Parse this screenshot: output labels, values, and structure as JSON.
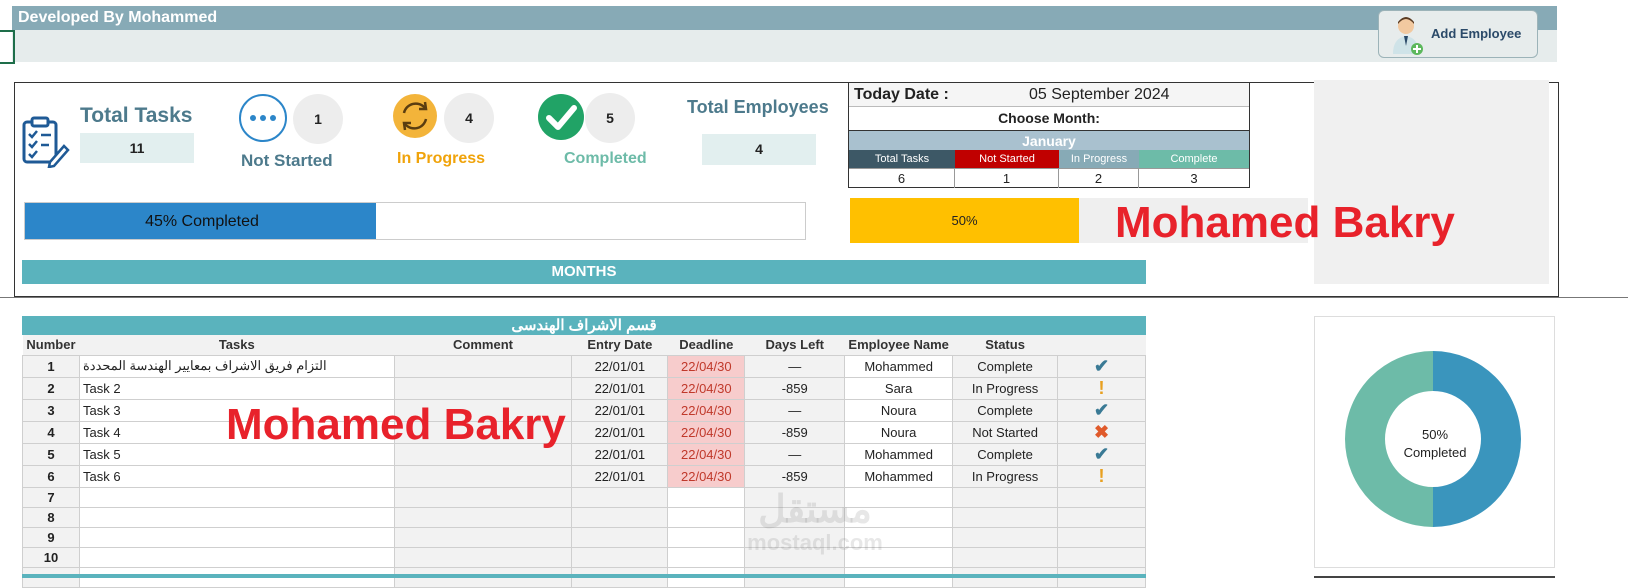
{
  "header": {
    "developer": "Developed By Mohammed",
    "add_employee_label": "Add Employee"
  },
  "kpis": {
    "total_tasks_label": "Total Tasks",
    "total_tasks_value": "11",
    "not_started_label": "Not Started",
    "not_started_value": "1",
    "in_progress_label": "In Progress",
    "in_progress_value": "4",
    "completed_label": "Completed",
    "completed_value": "5",
    "total_employees_label": "Total Employees",
    "total_employees_value": "4"
  },
  "date_block": {
    "today_label": "Today Date :",
    "today_value": "05 September 2024",
    "choose_month_label": "Choose Month:",
    "selected_month": "January",
    "columns": [
      "Total Tasks",
      "Not Started",
      "In Progress",
      "Complete"
    ],
    "values": [
      "6",
      "1",
      "2",
      "3"
    ]
  },
  "progress": {
    "overall_label": "45% Completed",
    "overall_fraction": 0.45,
    "month_label": "50%",
    "month_fraction": 0.5
  },
  "watermark_name": "Mohamed Bakry",
  "months_label": "MONTHS",
  "department_title": "قسم الاشراف الهندسى",
  "table": {
    "headers": [
      "Number",
      "Tasks",
      "Comment",
      "Entry Date",
      "Deadline",
      "Days Left",
      "Employee Name",
      "Status"
    ],
    "rows": [
      {
        "num": "1",
        "task": "التزام فريق الاشراف بمعايير الهندسة المحددة",
        "comment": "",
        "entry": "22/01/01",
        "deadline": "22/04/30",
        "days": "—",
        "employee": "Mohammed",
        "status": "Complete"
      },
      {
        "num": "2",
        "task": "Task 2",
        "comment": "",
        "entry": "22/01/01",
        "deadline": "22/04/30",
        "days": "-859",
        "employee": "Sara",
        "status": "In Progress"
      },
      {
        "num": "3",
        "task": "Task 3",
        "comment": "",
        "entry": "22/01/01",
        "deadline": "22/04/30",
        "days": "—",
        "employee": "Noura",
        "status": "Complete"
      },
      {
        "num": "4",
        "task": "Task 4",
        "comment": "",
        "entry": "22/01/01",
        "deadline": "22/04/30",
        "days": "-859",
        "employee": "Noura",
        "status": "Not Started"
      },
      {
        "num": "5",
        "task": "Task 5",
        "comment": "",
        "entry": "22/01/01",
        "deadline": "22/04/30",
        "days": "—",
        "employee": "Mohammed",
        "status": "Complete"
      },
      {
        "num": "6",
        "task": "Task 6",
        "comment": "",
        "entry": "22/01/01",
        "deadline": "22/04/30",
        "days": "-859",
        "employee": "Mohammed",
        "status": "In Progress"
      },
      {
        "num": "7"
      },
      {
        "num": "8"
      },
      {
        "num": "9"
      },
      {
        "num": "10"
      },
      {
        "num": ""
      }
    ]
  },
  "donut": {
    "center_line1": "50%",
    "center_line2": "Completed",
    "completed_fraction": 0.5,
    "colors": {
      "completed": "#3a95bd",
      "remaining": "#6dbba8"
    }
  },
  "site_watermark": {
    "arabic": "مستقل",
    "latin": "mostaql.com"
  },
  "colors": {
    "teal_header": "#5ab3bd",
    "not_started_red": "#c00000",
    "complete_green": "#6dbba8",
    "progress_blue": "#2c86c9",
    "progress_yellow": "#ffc000"
  },
  "icons": {
    "total_tasks": "clipboard-checklist-icon",
    "not_started": "ellipsis-icon",
    "in_progress": "refresh-icon",
    "completed": "check-circle-icon",
    "add_employee": "user-add-icon"
  }
}
